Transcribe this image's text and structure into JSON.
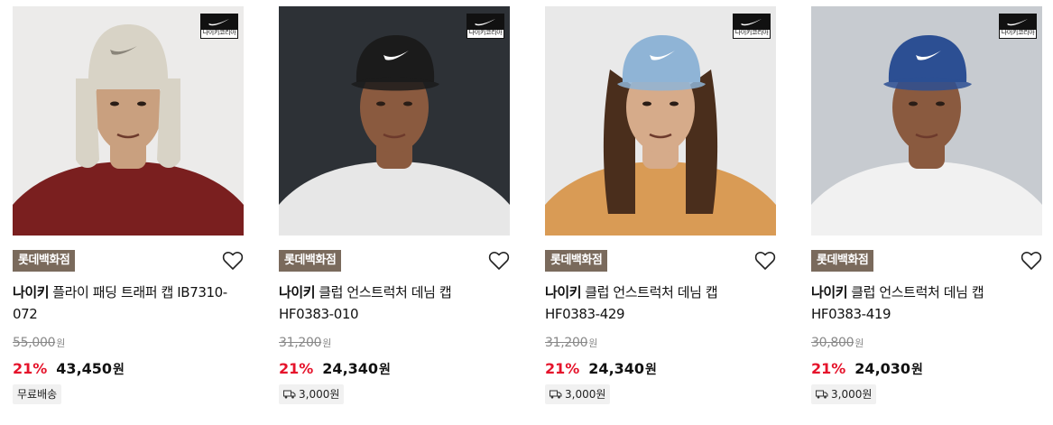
{
  "products": [
    {
      "brand_mark_text": "나이키코리아",
      "store": "롯데백화점",
      "brand": "나이키",
      "name": "플라이 패딩 트래퍼 캡 IB7310-072",
      "original_price": "55,000",
      "original_unit": "원",
      "discount": "21%",
      "sale_price": "43,450",
      "sale_unit": "원",
      "shipping": "무료배송",
      "shipping_icon": "",
      "photo": {
        "bg": "#ecebea",
        "cap": "#d8d3c6",
        "shirt": "#7a1f1f",
        "skin": "#c9a07f",
        "hair": "#1c1c1c",
        "style": "trapper"
      }
    },
    {
      "brand_mark_text": "나이키코리아",
      "store": "롯데백화점",
      "brand": "나이키",
      "name": "클럽 언스트럭처 데님 캡 HF0383-010",
      "original_price": "31,200",
      "original_unit": "원",
      "discount": "21%",
      "sale_price": "24,340",
      "sale_unit": "원",
      "shipping": "3,000원",
      "shipping_icon": "truck-icon",
      "photo": {
        "bg": "#2d3136",
        "cap": "#1b1b1b",
        "shirt": "#e7e7e7",
        "skin": "#8a5a3f",
        "hair": "#1b1b1b",
        "style": "cap"
      }
    },
    {
      "brand_mark_text": "나이키코리아",
      "store": "롯데백화점",
      "brand": "나이키",
      "name": "클럽 언스트럭처 데님 캡 HF0383-429",
      "original_price": "31,200",
      "original_unit": "원",
      "discount": "21%",
      "sale_price": "24,340",
      "sale_unit": "원",
      "shipping": "3,000원",
      "shipping_icon": "truck-icon",
      "photo": {
        "bg": "#e9e9e9",
        "cap": "#8fb4d6",
        "shirt": "#d99b55",
        "skin": "#d6ab8a",
        "hair": "#4a2e1c",
        "style": "cap-longhair"
      }
    },
    {
      "brand_mark_text": "나이키코리아",
      "store": "롯데백화점",
      "brand": "나이키",
      "name": "클럽 언스트럭처 데님 캡 HF0383-419",
      "original_price": "30,800",
      "original_unit": "원",
      "discount": "21%",
      "sale_price": "24,030",
      "sale_unit": "원",
      "shipping": "3,000원",
      "shipping_icon": "truck-icon",
      "photo": {
        "bg": "#c7cbd0",
        "cap": "#2c4f93",
        "shirt": "#f1f1f1",
        "skin": "#8a5a3f",
        "hair": "#1b1b1b",
        "style": "cap"
      }
    }
  ],
  "colors": {
    "accent_red": "#e5132b",
    "badge_brown": "#7a6a5c"
  }
}
